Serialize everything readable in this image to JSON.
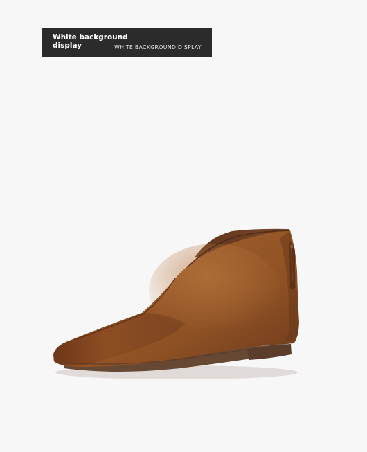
{
  "banner": {
    "title": "White background display",
    "subtitle": "WHITE BACKGROUND DISPLAY"
  },
  "product": {
    "image_subject": "brown-leather-ankle-boot",
    "colors": {
      "background": "#f8f7f8",
      "banner": "#2b2b2b",
      "leather": "#8a4f22",
      "sole": "#6a4a33"
    }
  }
}
